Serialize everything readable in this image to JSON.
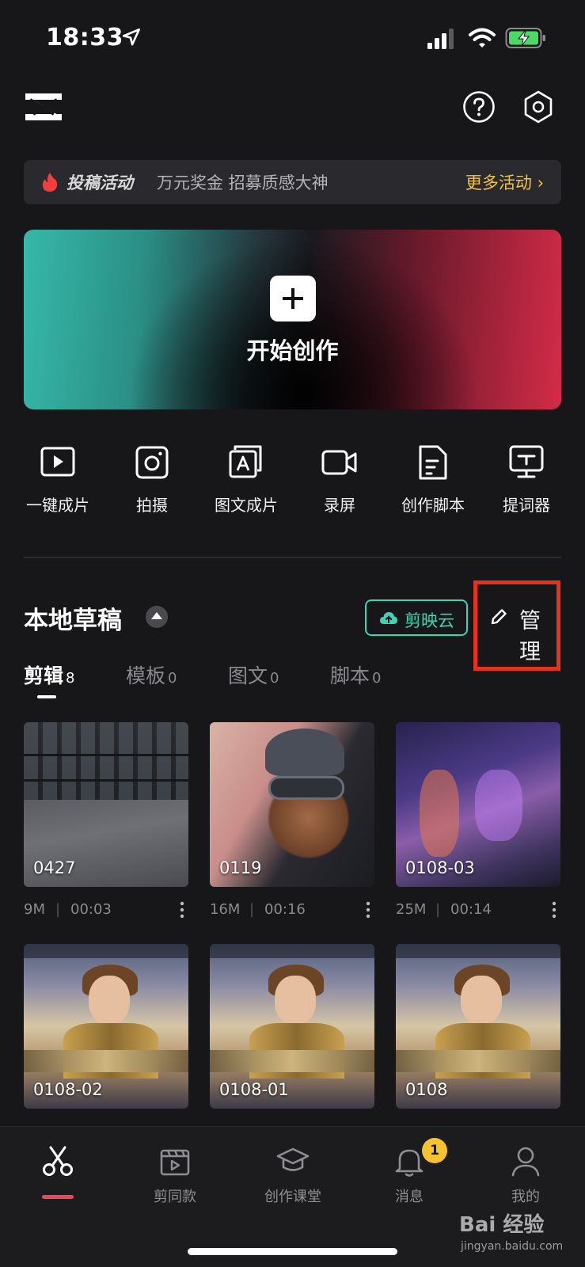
{
  "status_bar": {
    "time": "18:33"
  },
  "banner": {
    "tag": "投稿活动",
    "text": "万元奖金 招募质感大神",
    "more": "更多活动 ›"
  },
  "hero": {
    "label": "开始创作"
  },
  "tools": [
    {
      "label": "一键成片",
      "icon": "play-icon"
    },
    {
      "label": "拍摄",
      "icon": "camera-icon"
    },
    {
      "label": "图文成片",
      "icon": "text-image-icon"
    },
    {
      "label": "录屏",
      "icon": "screen-record-icon"
    },
    {
      "label": "创作脚本",
      "icon": "script-icon"
    },
    {
      "label": "提词器",
      "icon": "teleprompter-icon"
    }
  ],
  "drafts": {
    "title": "本地草稿",
    "cloud_label": "剪映云",
    "manage_label": "管理",
    "tabs": [
      {
        "label": "剪辑",
        "count": "8",
        "active": true
      },
      {
        "label": "模板",
        "count": "0",
        "active": false
      },
      {
        "label": "图文",
        "count": "0",
        "active": false
      },
      {
        "label": "脚本",
        "count": "0",
        "active": false
      }
    ],
    "items": [
      {
        "name": "0427",
        "size": "9M",
        "duration": "00:03"
      },
      {
        "name": "0119",
        "size": "16M",
        "duration": "00:16"
      },
      {
        "name": "0108-03",
        "size": "25M",
        "duration": "00:14"
      },
      {
        "name": "0108-02",
        "size": "",
        "duration": ""
      },
      {
        "name": "0108-01",
        "size": "",
        "duration": ""
      },
      {
        "name": "0108",
        "size": "",
        "duration": ""
      }
    ]
  },
  "bottom_nav": [
    {
      "label": "",
      "icon": "scissors-icon",
      "active": true
    },
    {
      "label": "剪同款",
      "icon": "template-icon"
    },
    {
      "label": "创作课堂",
      "icon": "graduation-cap-icon"
    },
    {
      "label": "消息",
      "icon": "bell-icon",
      "badge": "1"
    },
    {
      "label": "我的",
      "icon": "profile-icon"
    }
  ],
  "watermark": {
    "main": "Bai 经验",
    "sub": "jingyan.baidu.com"
  },
  "colors": {
    "accent_teal": "#3fd2b3",
    "highlight_red": "#e8301f",
    "promo_yellow": "#f5c242",
    "nav_active": "#f2445c"
  }
}
